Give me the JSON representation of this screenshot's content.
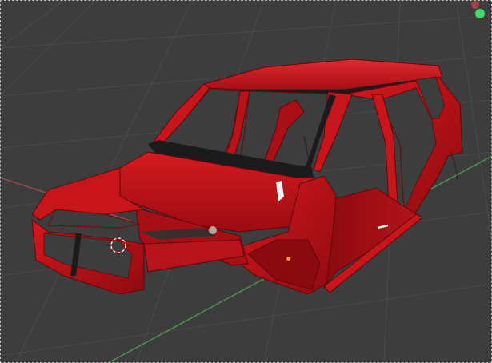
{
  "viewport": {
    "name": "3D Viewport",
    "background": "#3d3d3d",
    "grid_color": "#4a4a4a",
    "x_axis_color": "#9b4a4a",
    "y_axis_color": "#4e8f4e",
    "frame_style": "dashed"
  },
  "scene": {
    "object": "car-body-shell",
    "object_color": "#c8141b",
    "highlight_color": "#f0454a",
    "shadow_color": "#6d0a0d",
    "trim_color": "#1b1b1b"
  },
  "overlays": {
    "cursor_3d": "3d-cursor-icon",
    "origin_marker_color": "#f4a61b",
    "gizmo_top_color": "#a04545",
    "gizmo_bottom_color": "#3ed96b"
  }
}
